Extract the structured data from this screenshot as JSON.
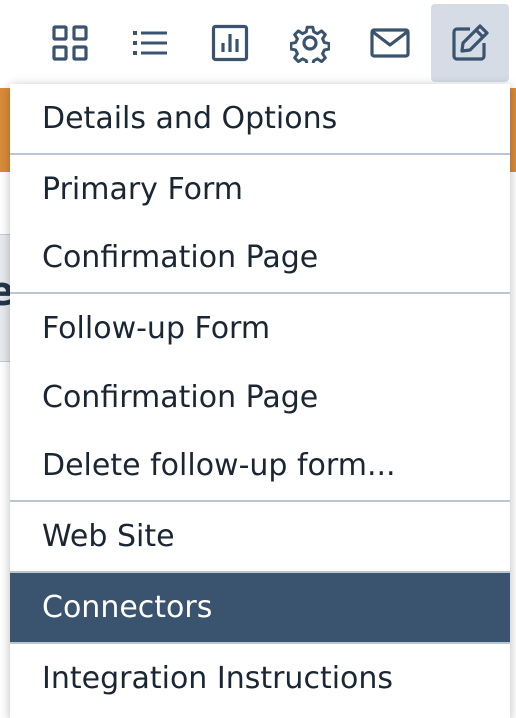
{
  "toolbar": {
    "buttons": [
      {
        "icon": "grid-icon",
        "active": false
      },
      {
        "icon": "list-icon",
        "active": false
      },
      {
        "icon": "bar-chart-icon",
        "active": false
      },
      {
        "icon": "gear-icon",
        "active": false
      },
      {
        "icon": "envelope-icon",
        "active": false
      },
      {
        "icon": "edit-icon",
        "active": true
      }
    ],
    "icon_color": "#3a536e"
  },
  "background": {
    "panel_letter": "e"
  },
  "menu": {
    "items": [
      {
        "label": "Details and Options"
      },
      {
        "label": "Primary Form"
      },
      {
        "label": "Confirmation Page"
      },
      {
        "label": "Follow-up Form"
      },
      {
        "label": "Confirmation Page"
      },
      {
        "label": "Delete follow-up form..."
      },
      {
        "label": "Web Site"
      },
      {
        "label": "Connectors",
        "selected": true
      },
      {
        "label": "Integration Instructions"
      }
    ],
    "selected_color": "#3a536e"
  }
}
